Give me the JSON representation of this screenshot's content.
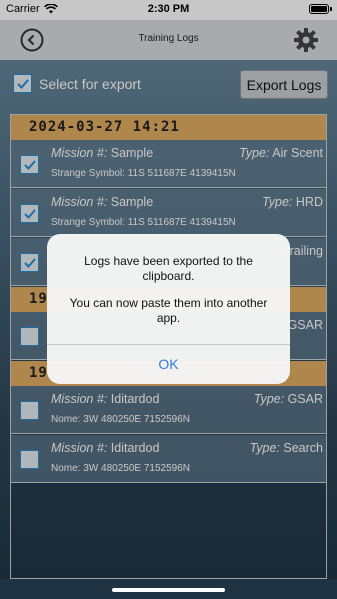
{
  "status_bar": {
    "carrier": "Carrier",
    "time": "2:30 PM"
  },
  "nav": {
    "title": "Training Logs"
  },
  "export": {
    "select_label": "Select for export",
    "export_button": "Export Logs",
    "select_all_checked": true
  },
  "labels": {
    "mission": "Mission #:",
    "type": "Type:"
  },
  "groups": [
    {
      "date": "2024-03-27  14:21",
      "logs": [
        {
          "mission": "Sample",
          "type": "Air Scent",
          "symbol": "Strange Symbol: 11S 511687E  4139415N",
          "checked": true
        },
        {
          "mission": "Sample",
          "type": "HRD",
          "symbol": "Strange Symbol: 11S 511687E  4139415N",
          "checked": true
        },
        {
          "mission": "",
          "type": "Trailing",
          "symbol": "",
          "checked": true
        }
      ]
    },
    {
      "date": "19",
      "logs": [
        {
          "mission": "",
          "type": "GSAR",
          "symbol": "",
          "checked": false
        }
      ]
    },
    {
      "date": "19",
      "logs": [
        {
          "mission": "Iditardod",
          "type": "GSAR",
          "symbol": "Nome: 3W 480250E  7152596N",
          "checked": false
        },
        {
          "mission": "Iditardod",
          "type": "Search",
          "symbol": "Nome: 3W 480250E  7152596N",
          "checked": false
        }
      ]
    }
  ],
  "alert": {
    "message_line1": "Logs have been exported to the clipboard.",
    "message_line2": "You can now paste them into another app.",
    "ok_label": "OK"
  }
}
